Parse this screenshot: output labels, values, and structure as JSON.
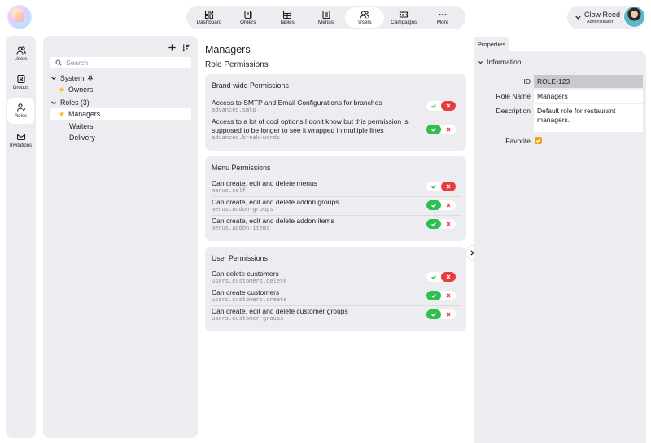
{
  "nav": {
    "items": [
      {
        "label": "Dashboard",
        "icon": "dashboard-icon"
      },
      {
        "label": "Orders",
        "icon": "orders-icon"
      },
      {
        "label": "Tables",
        "icon": "table-icon"
      },
      {
        "label": "Menus",
        "icon": "menu-book-icon"
      },
      {
        "label": "Users",
        "icon": "users-icon"
      },
      {
        "label": "Campaigns",
        "icon": "ticket-icon"
      },
      {
        "label": "More",
        "icon": "more-dots-icon"
      }
    ],
    "active": "Users"
  },
  "user": {
    "name": "Clow Reed",
    "role": "Administrator"
  },
  "rail": {
    "items": [
      {
        "label": "Users",
        "icon": "users-icon"
      },
      {
        "label": "Groups",
        "icon": "groups-icon"
      },
      {
        "label": "Roles",
        "icon": "roles-icon"
      },
      {
        "label": "Invitations",
        "icon": "mail-icon"
      }
    ],
    "active": "Roles"
  },
  "tree": {
    "search_placeholder": "Search",
    "system_label": "System",
    "owners_label": "Owners",
    "roles_label": "Roles (3)",
    "managers_label": "Managers",
    "waiters_label": "Waiters",
    "delivery_label": "Delivery"
  },
  "main": {
    "title": "Managers",
    "subtitle": "Role Permissions",
    "cards": [
      {
        "title": "Brand-wide Permissions",
        "rows": [
          {
            "label": "Access to SMTP and Email Configurations for branches",
            "key": "advanced.smtp",
            "state": "deny"
          },
          {
            "label": "Access to a lot of cool options I don't know but this permission is supposed to be longer to see it wrapped in multiple lines",
            "key": "advanced.break-words",
            "state": "allow"
          }
        ]
      },
      {
        "title": "Menu Permissions",
        "rows": [
          {
            "label": "Can create, edit and delete menus",
            "key": "menus.self",
            "state": "deny"
          },
          {
            "label": "Can create, edit and delete addon groups",
            "key": "menus.addon-groups",
            "state": "allow"
          },
          {
            "label": "Can create, edit and delete addon items",
            "key": "menus.addon-items",
            "state": "allow"
          }
        ]
      },
      {
        "title": "User Permissions",
        "rows": [
          {
            "label": "Can delete customers",
            "key": "users.customers.delete",
            "state": "deny"
          },
          {
            "label": "Can create customers",
            "key": "users.customers.create",
            "state": "allow"
          },
          {
            "label": "Can create, edit and delete customer groups",
            "key": "users.customer-groups",
            "state": "allow"
          }
        ]
      }
    ]
  },
  "properties": {
    "tab": "Properties",
    "section": "Information",
    "id_label": "ID",
    "id_value": "ROLE-123",
    "name_label": "Role Name",
    "name_value": "Managers",
    "desc_label": "Description",
    "desc_value": "Default role for restaurant managers.",
    "fav_label": "Favorite",
    "favorite": true
  },
  "colors": {
    "accent_green": "#2fbf50",
    "accent_red": "#ea3c3c",
    "favorite_orange": "#f0a323",
    "panel_gray": "#ececf1"
  }
}
